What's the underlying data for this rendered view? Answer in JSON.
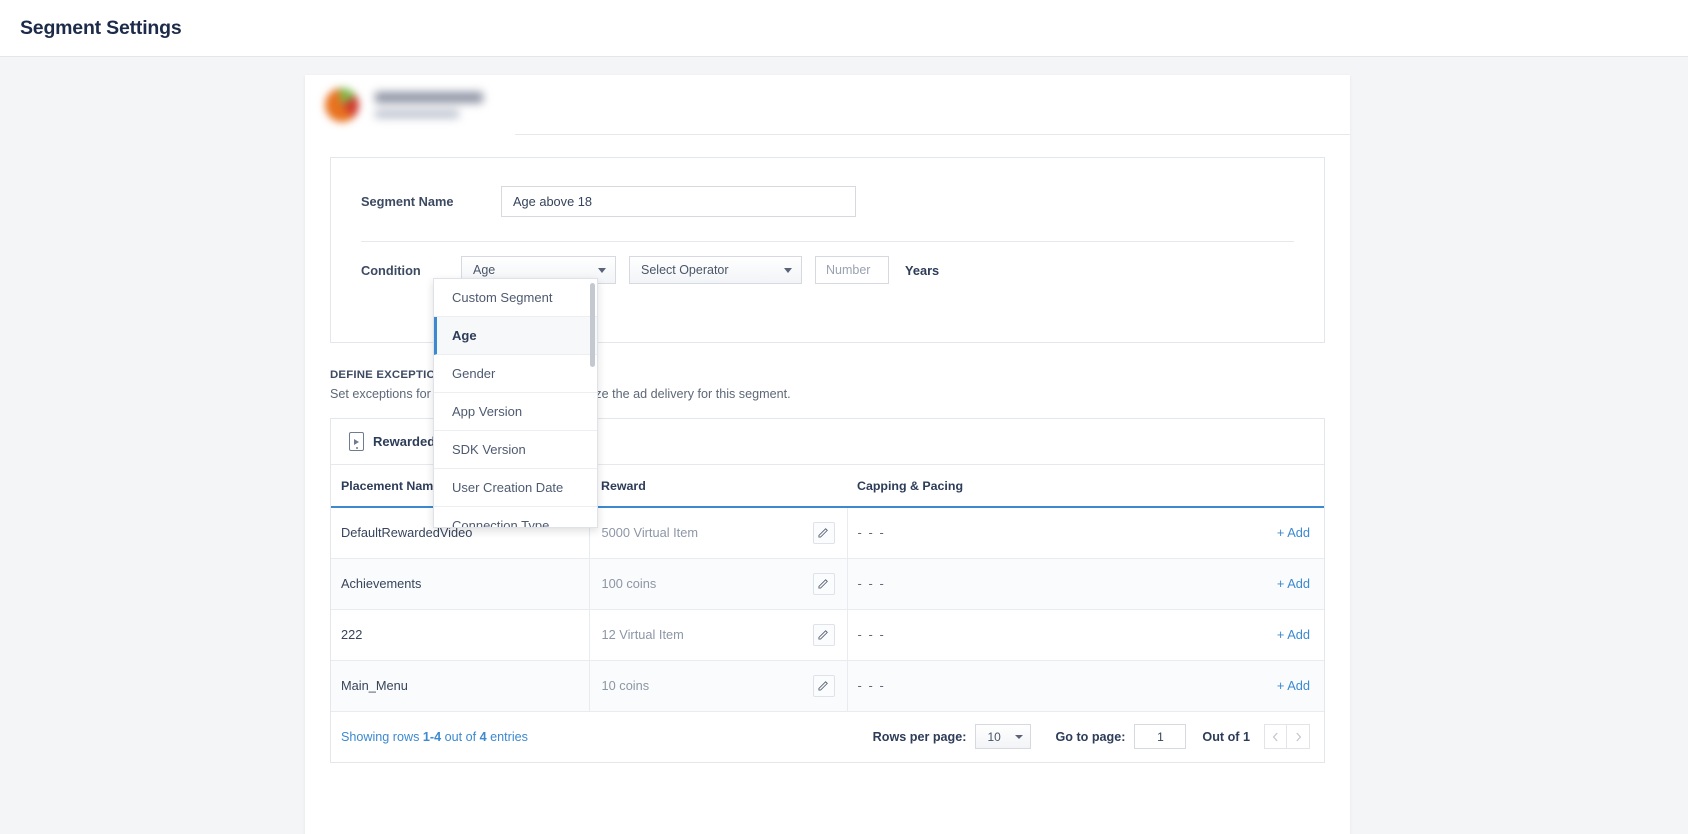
{
  "header": {
    "title": "Segment Settings"
  },
  "app": {
    "avatar_icon": "app-avatar-blurred",
    "name_redacted": "",
    "subtitle_redacted": ""
  },
  "form": {
    "segment_name_label": "Segment Name",
    "segment_name_value": "Age above 18",
    "condition_label": "Condition",
    "condition_value": "Age",
    "operator_placeholder": "Select Operator",
    "number_placeholder": "Number",
    "unit_label": "Years"
  },
  "dropdown": {
    "open": true,
    "selected": "Age",
    "items": [
      {
        "label": "Custom Segment"
      },
      {
        "label": "Age"
      },
      {
        "label": "Gender"
      },
      {
        "label": "App Version"
      },
      {
        "label": "SDK Version"
      },
      {
        "label": "User Creation Date"
      },
      {
        "label": "Connection Type"
      }
    ]
  },
  "exceptions": {
    "title": "DEFINE EXCEPTIONS",
    "description": "Set exceptions for specific placements to optimize the ad delivery for this segment."
  },
  "table": {
    "tab_label": "Rewarded Video",
    "tab_icon": "rewarded-video-icon",
    "columns": [
      "Placement Name",
      "Reward",
      "Capping & Pacing",
      ""
    ],
    "edit_icon": "pencil-icon",
    "add_label": "+ Add",
    "rows": [
      {
        "name": "DefaultRewardedVideo",
        "reward": "5000 Virtual Item",
        "capping": "- - -",
        "action": "+ Add"
      },
      {
        "name": "Achievements",
        "reward": "100 coins",
        "capping": "- - -",
        "action": "+ Add"
      },
      {
        "name": "222",
        "reward": "12 Virtual Item",
        "capping": "- - -",
        "action": "+ Add"
      },
      {
        "name": "Main_Menu",
        "reward": "10 coins",
        "capping": "- - -",
        "action": "+ Add"
      }
    ]
  },
  "footer": {
    "showing_prefix": "Showing rows ",
    "showing_range": "1-4",
    "showing_mid": " out of ",
    "showing_count": "4",
    "showing_suffix": " entries",
    "rows_per_page_label": "Rows per page:",
    "rows_per_page_value": "10",
    "go_to_page_label": "Go to page:",
    "go_to_page_value": "1",
    "out_of_label": "Out of 1",
    "prev_icon": "chevron-left-icon",
    "next_icon": "chevron-right-icon"
  },
  "colors": {
    "accent": "#3c89d0",
    "text_dark": "#2d3c58",
    "muted": "#8d96a6"
  }
}
